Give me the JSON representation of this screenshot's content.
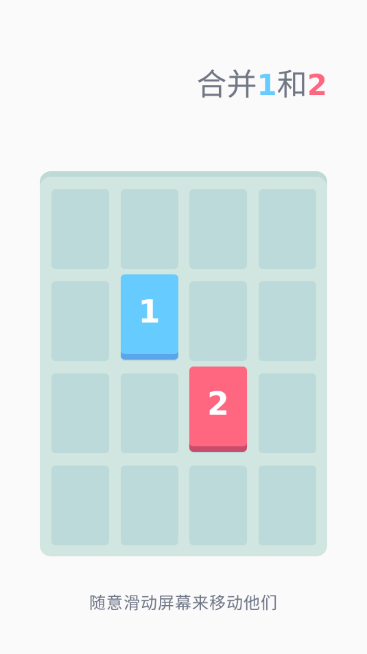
{
  "title": {
    "part1": "合并",
    "num1": "1",
    "part2": "和",
    "num2": "2"
  },
  "colors": {
    "tile_1": "#66ccff",
    "tile_2": "#ff6680",
    "board": "#d1e6e0",
    "cell": "#bcdad9",
    "text": "#717784"
  },
  "board": {
    "rows": 4,
    "cols": 4,
    "tiles": [
      {
        "value": "1",
        "row": 1,
        "col": 1
      },
      {
        "value": "2",
        "row": 2,
        "col": 2
      }
    ]
  },
  "hint": "随意滑动屏幕来移动他们"
}
